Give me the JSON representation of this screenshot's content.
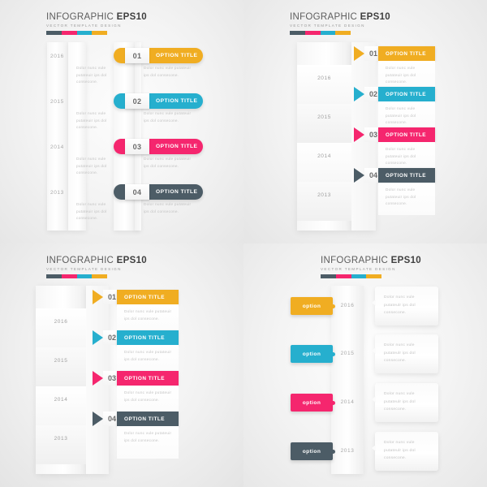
{
  "header": {
    "title_light": "INFOGRAPHIC ",
    "title_bold": "EPS10",
    "subtitle": "VECTOR TEMPLATE DESIGN",
    "bar_colors": [
      "#4C5C66",
      "#F5266E",
      "#26AFCE",
      "#F0AD22"
    ]
  },
  "palette": {
    "yellow": "#F0AD22",
    "cyan": "#26AFCE",
    "pink": "#F5266E",
    "slate": "#4C5C66",
    "background": "#ececec",
    "text_muted": "#c2c2c2",
    "year_color": "#a9a9a9"
  },
  "body_text": "Dolor nunc vule putateuir ips dol consecone.",
  "bubble_text": "Dolor  nunc vule putateulr ips dol consecone.",
  "option_tag_label": "option",
  "panels": [
    {
      "id": "panel-rounded-pill",
      "style": "rounded-pill",
      "rows": [
        {
          "number": "01",
          "year": "2016",
          "title": "OPTION TITLE",
          "color": "#F0AD22"
        },
        {
          "number": "02",
          "year": "2015",
          "title": "OPTION TITLE",
          "color": "#26AFCE"
        },
        {
          "number": "03",
          "year": "2014",
          "title": "OPTION TITLE",
          "color": "#F5266E"
        },
        {
          "number": "04",
          "year": "2013",
          "title": "OPTION TITLE",
          "color": "#4C5C66"
        }
      ]
    },
    {
      "id": "panel-arrow-bars",
      "style": "arrow-bars",
      "rows": [
        {
          "number": "01",
          "year": "2016",
          "title": "OPTION TITLE",
          "color": "#F0AD22"
        },
        {
          "number": "02",
          "year": "2015",
          "title": "OPTION TITLE",
          "color": "#26AFCE"
        },
        {
          "number": "03",
          "year": "2014",
          "title": "OPTION TITLE",
          "color": "#F5266E"
        },
        {
          "number": "04",
          "year": "2013",
          "title": "OPTION TITLE",
          "color": "#4C5C66"
        }
      ]
    },
    {
      "id": "panel-arrow-bars-narrow",
      "style": "arrow-bars-narrow",
      "rows": [
        {
          "number": "01",
          "year": "2016",
          "title": "OPTION TITLE",
          "color": "#F0AD22"
        },
        {
          "number": "02",
          "year": "2015",
          "title": "OPTION TITLE",
          "color": "#26AFCE"
        },
        {
          "number": "03",
          "year": "2014",
          "title": "OPTION TITLE",
          "color": "#F5266E"
        },
        {
          "number": "04",
          "year": "2013",
          "title": "OPTION TITLE",
          "color": "#4C5C66"
        }
      ]
    },
    {
      "id": "panel-option-tags",
      "style": "option-tags",
      "rows": [
        {
          "label": "option",
          "year": "2016",
          "color": "#F0AD22"
        },
        {
          "label": "option",
          "year": "2015",
          "color": "#26AFCE"
        },
        {
          "label": "option",
          "year": "2014",
          "color": "#F5266E"
        },
        {
          "label": "option",
          "year": "2013",
          "color": "#4C5C66"
        }
      ]
    }
  ]
}
